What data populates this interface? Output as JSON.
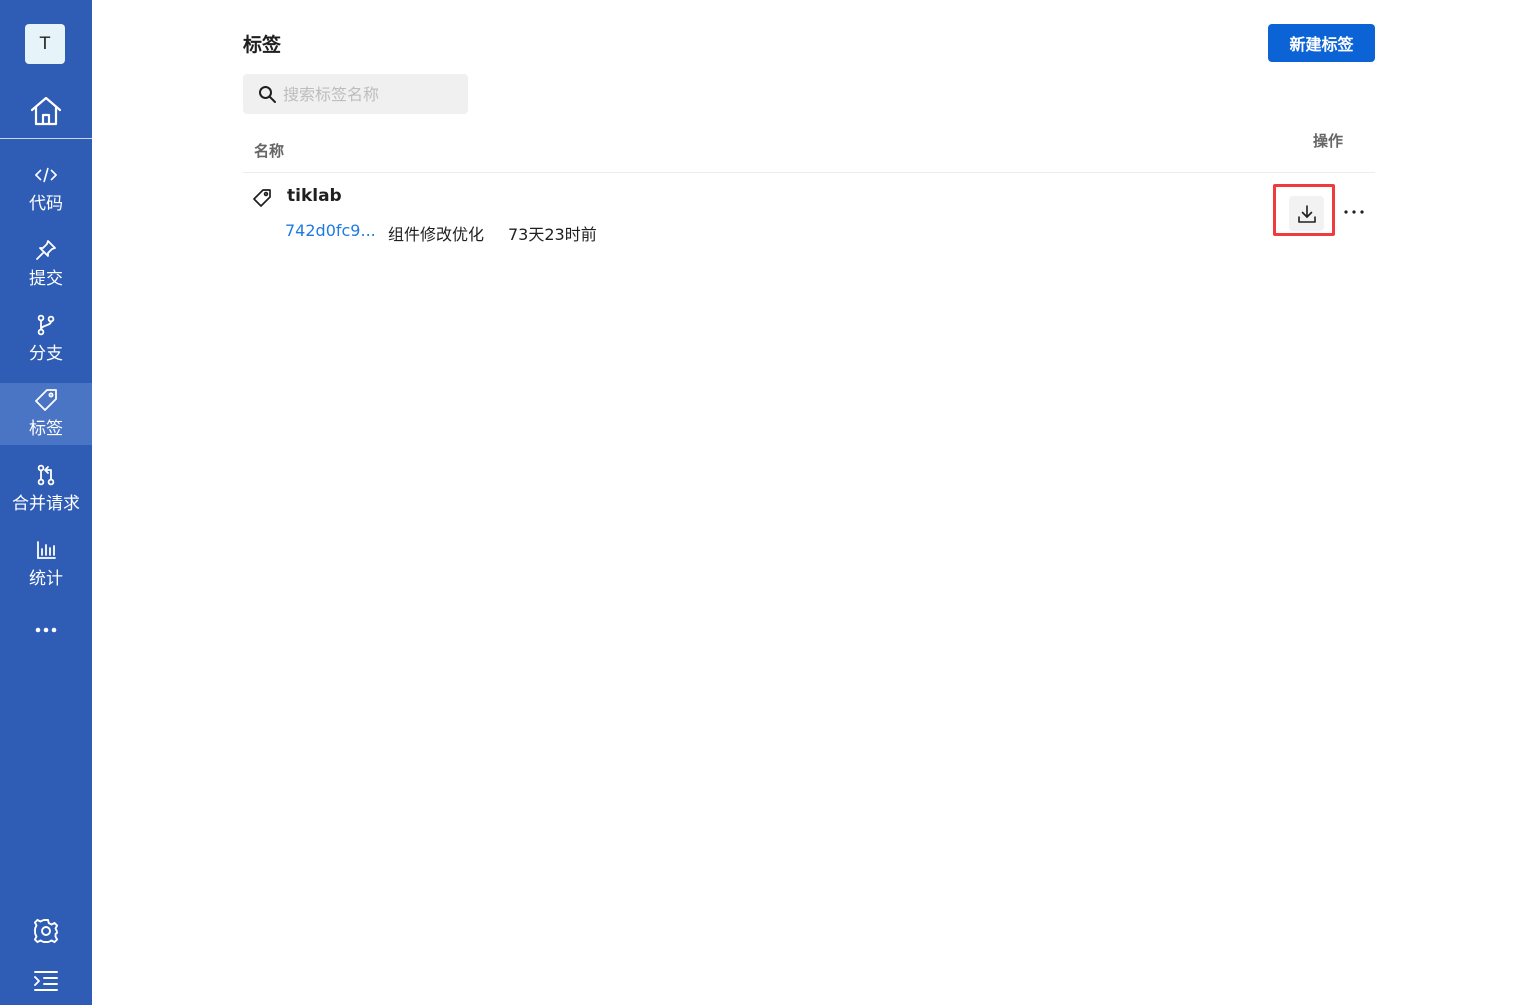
{
  "sidebar": {
    "avatar_letter": "T",
    "items": [
      {
        "label": "代码",
        "icon": "code-icon"
      },
      {
        "label": "提交",
        "icon": "pin-icon"
      },
      {
        "label": "分支",
        "icon": "branch-icon"
      },
      {
        "label": "标签",
        "icon": "tag-icon",
        "active": true
      },
      {
        "label": "合并请求",
        "icon": "merge-request-icon"
      },
      {
        "label": "统计",
        "icon": "bar-chart-icon"
      }
    ],
    "colors": {
      "background": "#2f5cb5",
      "active": "#4a74c4"
    }
  },
  "header": {
    "title": "标签",
    "new_button_label": "新建标签"
  },
  "search": {
    "placeholder": "搜索标签名称",
    "value": ""
  },
  "table": {
    "columns": {
      "name": "名称",
      "action": "操作"
    },
    "rows": [
      {
        "tag_name": "tiklab",
        "commit_hash": "742d0fc9...",
        "commit_message": "组件修改优化",
        "time": "73天23时前"
      }
    ]
  },
  "colors": {
    "primary": "#0b63d6",
    "link": "#1f7be0",
    "highlight_border": "#ef3b3b"
  }
}
